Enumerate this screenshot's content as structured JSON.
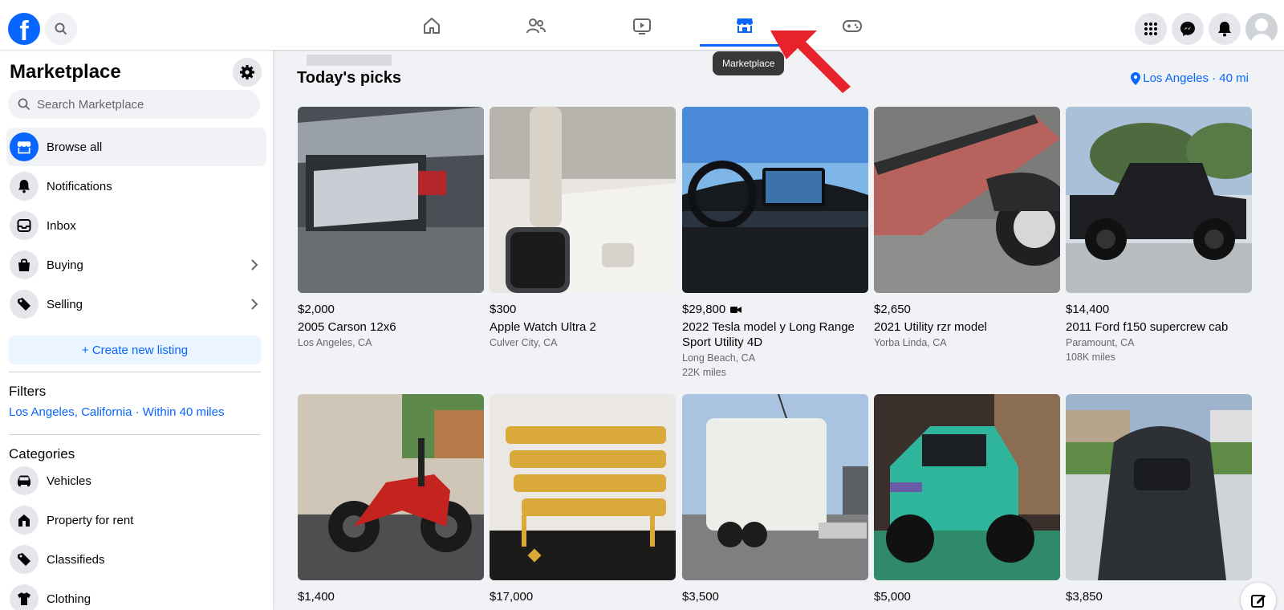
{
  "colors": {
    "accent": "#0866ff",
    "arrow": "#e8222a"
  },
  "tooltip": "Marketplace",
  "sidebar": {
    "title": "Marketplace",
    "search_placeholder": "Search Marketplace",
    "items": [
      {
        "label": "Browse all",
        "icon": "storefront-icon"
      },
      {
        "label": "Notifications",
        "icon": "bell-icon"
      },
      {
        "label": "Inbox",
        "icon": "inbox-icon"
      },
      {
        "label": "Buying",
        "icon": "shopping-bag-icon"
      },
      {
        "label": "Selling",
        "icon": "tag-icon"
      }
    ],
    "create_listing": "+ Create new listing",
    "filters_heading": "Filters",
    "filter_location": "Los Angeles, California · Within 40 miles",
    "categories_heading": "Categories",
    "categories": [
      {
        "label": "Vehicles",
        "icon": "car-icon"
      },
      {
        "label": "Property for rent",
        "icon": "house-icon"
      },
      {
        "label": "Classifieds",
        "icon": "tag-icon"
      },
      {
        "label": "Clothing",
        "icon": "shirt-icon"
      }
    ]
  },
  "main": {
    "heading": "Today's picks",
    "location": "Los Angeles · 40 mi",
    "listings": [
      {
        "price": "$2,000",
        "title": "2005 Carson 12x6",
        "location": "Los Angeles, CA",
        "extra": ""
      },
      {
        "price": "$300",
        "title": "Apple Watch Ultra 2",
        "location": "Culver City, CA",
        "extra": ""
      },
      {
        "price": "$29,800",
        "title": "2022 Tesla model y Long Range Sport Utility 4D",
        "location": "Long Beach, CA",
        "extra": "22K miles"
      },
      {
        "price": "$2,650",
        "title": "2021 Utility rzr model",
        "location": "Yorba Linda, CA",
        "extra": ""
      },
      {
        "price": "$14,400",
        "title": "2011 Ford f150 supercrew cab",
        "location": "Paramount, CA",
        "extra": "108K miles"
      },
      {
        "price": "$1,400",
        "title": "",
        "location": "",
        "extra": ""
      },
      {
        "price": "$17,000",
        "title": "",
        "location": "",
        "extra": ""
      },
      {
        "price": "$3,500",
        "title": "",
        "location": "",
        "extra": ""
      },
      {
        "price": "$5,000",
        "title": "",
        "location": "",
        "extra": ""
      },
      {
        "price": "$3,850",
        "title": "",
        "location": "",
        "extra": ""
      }
    ]
  }
}
